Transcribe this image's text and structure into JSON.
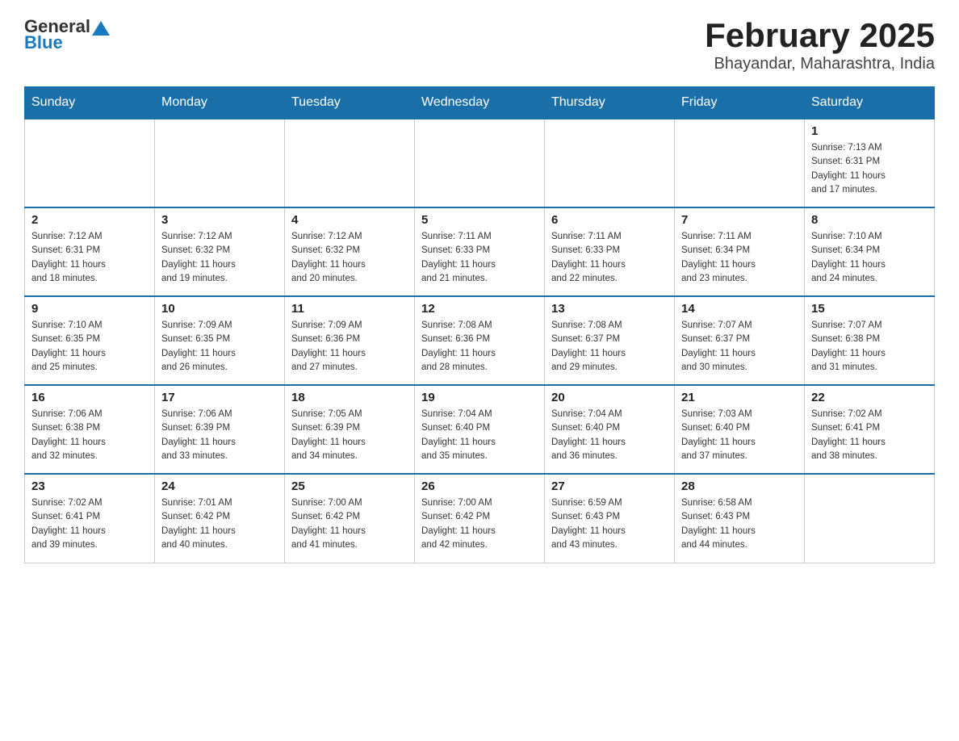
{
  "logo": {
    "text_general": "General",
    "text_blue": "Blue",
    "arrow": "▲"
  },
  "title": "February 2025",
  "subtitle": "Bhayandar, Maharashtra, India",
  "days_of_week": [
    "Sunday",
    "Monday",
    "Tuesday",
    "Wednesday",
    "Thursday",
    "Friday",
    "Saturday"
  ],
  "weeks": [
    {
      "days": [
        {
          "num": "",
          "info": "",
          "empty": true
        },
        {
          "num": "",
          "info": "",
          "empty": true
        },
        {
          "num": "",
          "info": "",
          "empty": true
        },
        {
          "num": "",
          "info": "",
          "empty": true
        },
        {
          "num": "",
          "info": "",
          "empty": true
        },
        {
          "num": "",
          "info": "",
          "empty": true
        },
        {
          "num": "1",
          "info": "Sunrise: 7:13 AM\nSunset: 6:31 PM\nDaylight: 11 hours\nand 17 minutes.",
          "empty": false
        }
      ]
    },
    {
      "days": [
        {
          "num": "2",
          "info": "Sunrise: 7:12 AM\nSunset: 6:31 PM\nDaylight: 11 hours\nand 18 minutes.",
          "empty": false
        },
        {
          "num": "3",
          "info": "Sunrise: 7:12 AM\nSunset: 6:32 PM\nDaylight: 11 hours\nand 19 minutes.",
          "empty": false
        },
        {
          "num": "4",
          "info": "Sunrise: 7:12 AM\nSunset: 6:32 PM\nDaylight: 11 hours\nand 20 minutes.",
          "empty": false
        },
        {
          "num": "5",
          "info": "Sunrise: 7:11 AM\nSunset: 6:33 PM\nDaylight: 11 hours\nand 21 minutes.",
          "empty": false
        },
        {
          "num": "6",
          "info": "Sunrise: 7:11 AM\nSunset: 6:33 PM\nDaylight: 11 hours\nand 22 minutes.",
          "empty": false
        },
        {
          "num": "7",
          "info": "Sunrise: 7:11 AM\nSunset: 6:34 PM\nDaylight: 11 hours\nand 23 minutes.",
          "empty": false
        },
        {
          "num": "8",
          "info": "Sunrise: 7:10 AM\nSunset: 6:34 PM\nDaylight: 11 hours\nand 24 minutes.",
          "empty": false
        }
      ]
    },
    {
      "days": [
        {
          "num": "9",
          "info": "Sunrise: 7:10 AM\nSunset: 6:35 PM\nDaylight: 11 hours\nand 25 minutes.",
          "empty": false
        },
        {
          "num": "10",
          "info": "Sunrise: 7:09 AM\nSunset: 6:35 PM\nDaylight: 11 hours\nand 26 minutes.",
          "empty": false
        },
        {
          "num": "11",
          "info": "Sunrise: 7:09 AM\nSunset: 6:36 PM\nDaylight: 11 hours\nand 27 minutes.",
          "empty": false
        },
        {
          "num": "12",
          "info": "Sunrise: 7:08 AM\nSunset: 6:36 PM\nDaylight: 11 hours\nand 28 minutes.",
          "empty": false
        },
        {
          "num": "13",
          "info": "Sunrise: 7:08 AM\nSunset: 6:37 PM\nDaylight: 11 hours\nand 29 minutes.",
          "empty": false
        },
        {
          "num": "14",
          "info": "Sunrise: 7:07 AM\nSunset: 6:37 PM\nDaylight: 11 hours\nand 30 minutes.",
          "empty": false
        },
        {
          "num": "15",
          "info": "Sunrise: 7:07 AM\nSunset: 6:38 PM\nDaylight: 11 hours\nand 31 minutes.",
          "empty": false
        }
      ]
    },
    {
      "days": [
        {
          "num": "16",
          "info": "Sunrise: 7:06 AM\nSunset: 6:38 PM\nDaylight: 11 hours\nand 32 minutes.",
          "empty": false
        },
        {
          "num": "17",
          "info": "Sunrise: 7:06 AM\nSunset: 6:39 PM\nDaylight: 11 hours\nand 33 minutes.",
          "empty": false
        },
        {
          "num": "18",
          "info": "Sunrise: 7:05 AM\nSunset: 6:39 PM\nDaylight: 11 hours\nand 34 minutes.",
          "empty": false
        },
        {
          "num": "19",
          "info": "Sunrise: 7:04 AM\nSunset: 6:40 PM\nDaylight: 11 hours\nand 35 minutes.",
          "empty": false
        },
        {
          "num": "20",
          "info": "Sunrise: 7:04 AM\nSunset: 6:40 PM\nDaylight: 11 hours\nand 36 minutes.",
          "empty": false
        },
        {
          "num": "21",
          "info": "Sunrise: 7:03 AM\nSunset: 6:40 PM\nDaylight: 11 hours\nand 37 minutes.",
          "empty": false
        },
        {
          "num": "22",
          "info": "Sunrise: 7:02 AM\nSunset: 6:41 PM\nDaylight: 11 hours\nand 38 minutes.",
          "empty": false
        }
      ]
    },
    {
      "days": [
        {
          "num": "23",
          "info": "Sunrise: 7:02 AM\nSunset: 6:41 PM\nDaylight: 11 hours\nand 39 minutes.",
          "empty": false
        },
        {
          "num": "24",
          "info": "Sunrise: 7:01 AM\nSunset: 6:42 PM\nDaylight: 11 hours\nand 40 minutes.",
          "empty": false
        },
        {
          "num": "25",
          "info": "Sunrise: 7:00 AM\nSunset: 6:42 PM\nDaylight: 11 hours\nand 41 minutes.",
          "empty": false
        },
        {
          "num": "26",
          "info": "Sunrise: 7:00 AM\nSunset: 6:42 PM\nDaylight: 11 hours\nand 42 minutes.",
          "empty": false
        },
        {
          "num": "27",
          "info": "Sunrise: 6:59 AM\nSunset: 6:43 PM\nDaylight: 11 hours\nand 43 minutes.",
          "empty": false
        },
        {
          "num": "28",
          "info": "Sunrise: 6:58 AM\nSunset: 6:43 PM\nDaylight: 11 hours\nand 44 minutes.",
          "empty": false
        },
        {
          "num": "",
          "info": "",
          "empty": true
        }
      ]
    }
  ]
}
